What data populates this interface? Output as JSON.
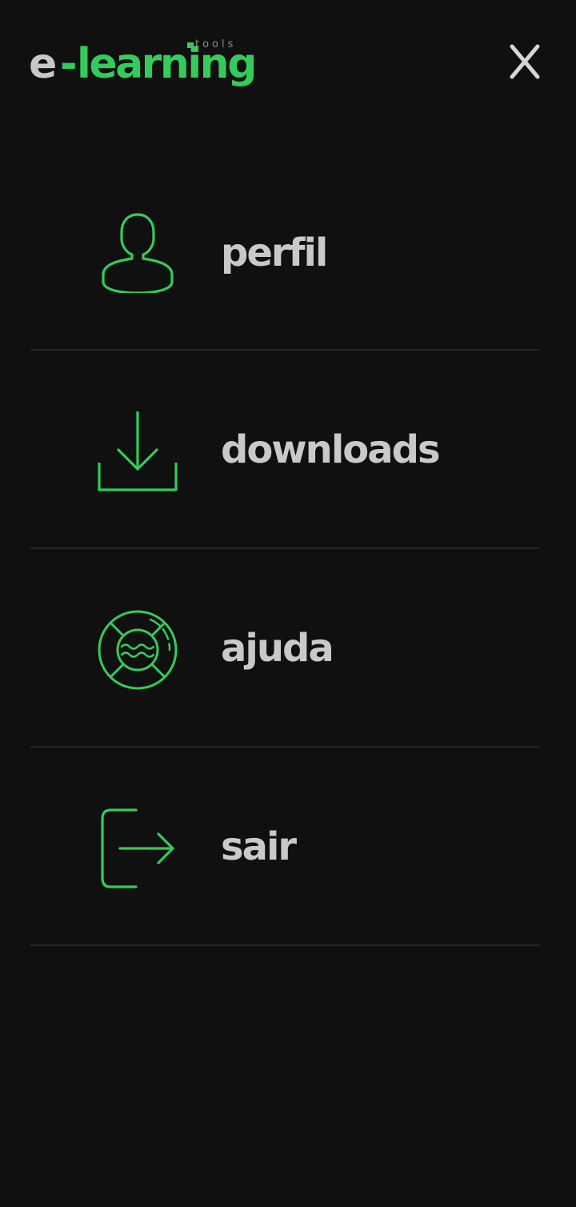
{
  "app": {
    "logo": {
      "prefix": "e",
      "dash": "-",
      "main": "learning",
      "suffix": "tools"
    },
    "close_icon": "close-icon"
  },
  "menu": {
    "items": [
      {
        "label": "perfil",
        "icon": "user-icon"
      },
      {
        "label": "downloads",
        "icon": "download-icon"
      },
      {
        "label": "ajuda",
        "icon": "lifebuoy-icon"
      },
      {
        "label": "sair",
        "icon": "logout-icon"
      }
    ]
  },
  "colors": {
    "background": "#101010",
    "accent": "#33cc5a",
    "text": "#c9c9c9",
    "divider": "#262626"
  }
}
